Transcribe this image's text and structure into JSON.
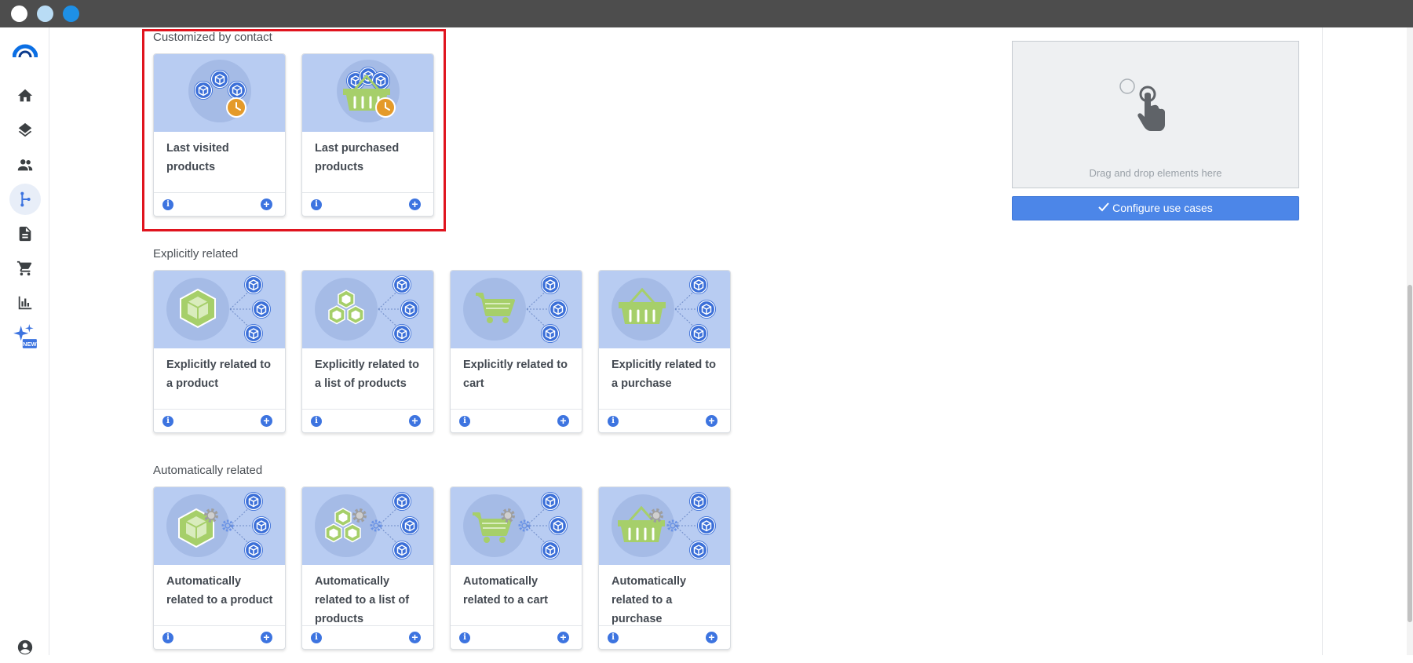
{
  "window": {
    "controls": [
      "close",
      "minimize",
      "maximize"
    ]
  },
  "sidebar": {
    "logo": "brand-logo",
    "items": [
      {
        "name": "home",
        "icon": "home-icon",
        "active": false
      },
      {
        "name": "layers",
        "icon": "layers-icon",
        "active": false
      },
      {
        "name": "contacts",
        "icon": "people-icon",
        "active": false
      },
      {
        "name": "flows",
        "icon": "branch-icon",
        "active": true
      },
      {
        "name": "documents",
        "icon": "document-icon",
        "active": false
      },
      {
        "name": "cart",
        "icon": "cart-icon",
        "active": false
      },
      {
        "name": "stats",
        "icon": "bar-chart-icon",
        "active": false
      },
      {
        "name": "ai",
        "icon": "sparkle-icon",
        "badge": "NEW",
        "active": false
      },
      {
        "name": "account",
        "icon": "user-circle-icon",
        "active": false
      }
    ]
  },
  "sections": {
    "customized": {
      "title": "Customized by contact",
      "cards": [
        {
          "title": "Last visited products"
        },
        {
          "title": "Last purchased products"
        }
      ]
    },
    "explicit": {
      "title": "Explicitly related",
      "cards": [
        {
          "title": "Explicitly related to a product"
        },
        {
          "title": "Explicitly related to a list of products"
        },
        {
          "title": "Explicitly related to cart"
        },
        {
          "title": "Explicitly related to a purchase"
        }
      ]
    },
    "automatic": {
      "title": "Automatically related",
      "cards": [
        {
          "title": "Automatically related to a product"
        },
        {
          "title": "Automatically related to a list of products"
        },
        {
          "title": "Automatically related to a cart"
        },
        {
          "title": "Automatically related to a purchase"
        }
      ]
    }
  },
  "card_actions": {
    "info": "i",
    "add": "+"
  },
  "dropzone": {
    "text": "Drag and drop elements here",
    "icon": "hand-pointer-icon"
  },
  "configure_button": {
    "label": "Configure use cases",
    "icon": "check-icon"
  },
  "colors": {
    "accent": "#4c86e8",
    "card_image_bg": "#b8ccf2",
    "highlight": "#e0141e",
    "icon_green": "#a6cf6a",
    "clock_orange": "#e49a2a"
  }
}
